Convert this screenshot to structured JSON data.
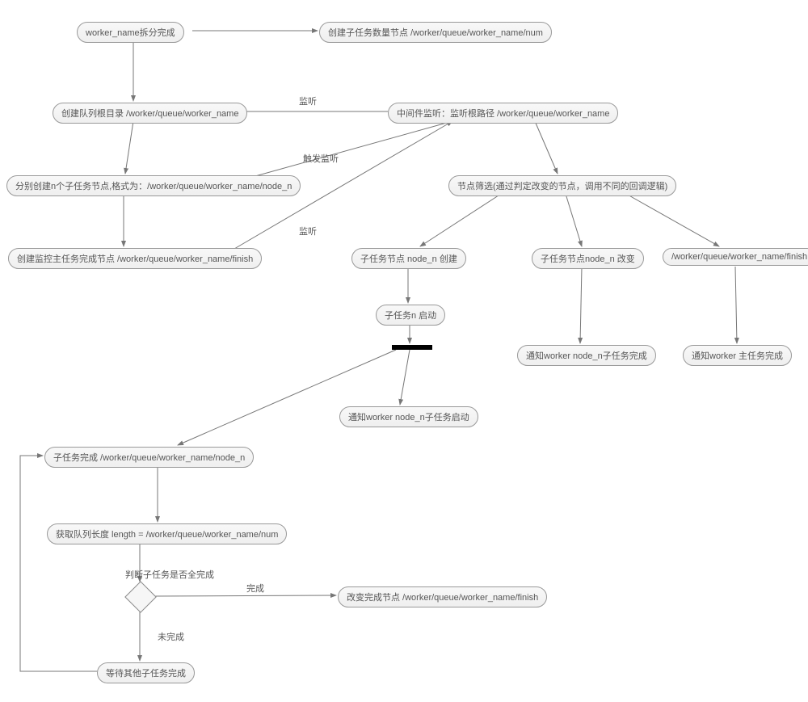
{
  "nodes": {
    "n1": "worker_name拆分完成",
    "n2": "创建子任务数量节点 /worker/queue/worker_name/num",
    "n3": "创建队列根目录 /worker/queue/worker_name",
    "n4": "中间件监听：监听根路径 /worker/queue/worker_name",
    "n5": "分别创建n个子任务节点,格式为：/worker/queue/worker_name/node_n",
    "n6": "节点筛选(通过判定改变的节点，调用不同的回调逻辑)",
    "n7": "创建监控主任务完成节点 /worker/queue/worker_name/finish",
    "n8": "子任务节点 node_n 创建",
    "n9": "子任务节点node_n 改变",
    "n10": "/worker/queue/worker_name/finish",
    "n11": "子任务n 启动",
    "n12": "通知worker node_n子任务完成",
    "n13": "通知worker 主任务完成",
    "n14": "通知worker node_n子任务启动",
    "n15": "子任务完成     /worker/queue/worker_name/node_n",
    "n16": "获取队列长度 length = /worker/queue/worker_name/num",
    "n17": "改变完成节点 /worker/queue/worker_name/finish",
    "n18": "等待其他子任务完成"
  },
  "edge_labels": {
    "e1": "监听",
    "e2": "触发监听",
    "e3": "监听",
    "e4": "判断子任务是否全完成",
    "e5": "完成",
    "e6": "未完成"
  }
}
